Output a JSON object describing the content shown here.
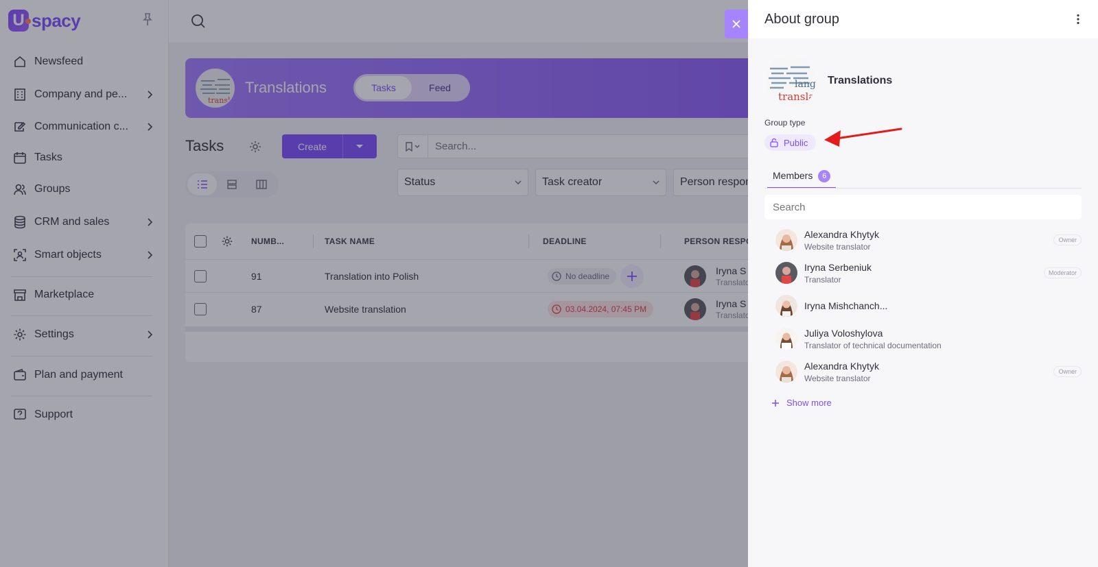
{
  "sidebar": {
    "logo": {
      "letter": "U",
      "text": "spacy"
    },
    "items": [
      {
        "label": "Newsfeed",
        "icon": "home-icon",
        "chevron": false
      },
      {
        "label": "Company and pe...",
        "icon": "building-icon",
        "chevron": true
      },
      {
        "label": "Communication c...",
        "icon": "chat-edit-icon",
        "chevron": true
      },
      {
        "label": "Tasks",
        "icon": "calendar-icon",
        "chevron": false
      },
      {
        "label": "Groups",
        "icon": "users-icon",
        "chevron": false
      },
      {
        "label": "CRM and sales",
        "icon": "database-icon",
        "chevron": true
      },
      {
        "label": "Smart objects",
        "icon": "scan-user-icon",
        "chevron": true
      },
      {
        "label": "Marketplace",
        "icon": "store-icon",
        "chevron": false
      },
      {
        "label": "Settings",
        "icon": "gear-icon",
        "chevron": true
      },
      {
        "label": "Plan and payment",
        "icon": "wallet-icon",
        "chevron": false
      },
      {
        "label": "Support",
        "icon": "help-icon",
        "chevron": false
      }
    ]
  },
  "banner": {
    "title": "Translations",
    "tabs": [
      {
        "label": "Tasks",
        "active": true
      },
      {
        "label": "Feed",
        "active": false
      }
    ]
  },
  "toolbar": {
    "title": "Tasks",
    "create_label": "Create",
    "search_placeholder": "Search..."
  },
  "filters": [
    "Status",
    "Task creator",
    "Person respon"
  ],
  "table": {
    "headers": [
      "NUMB...",
      "TASK NAME",
      "DEADLINE",
      "PERSON RESPON"
    ],
    "rows": [
      {
        "number": "91",
        "name": "Translation into Polish",
        "deadline": "No deadline",
        "overdue": false,
        "person": "Iryna S",
        "person_role": "Translato"
      },
      {
        "number": "87",
        "name": "Website translation",
        "deadline": "03.04.2024, 07:45 PM",
        "overdue": true,
        "person": "Iryna S",
        "person_role": "Translato"
      }
    ]
  },
  "panel": {
    "title": "About group",
    "group_name": "Translations",
    "group_type_label": "Group type",
    "group_type_value": "Public",
    "members_tab": "Members",
    "members_count": "6",
    "search_placeholder": "Search",
    "members": [
      {
        "name": "Alexandra Khytyk",
        "role": "Website translator",
        "tag": "Owner"
      },
      {
        "name": "Iryna Serbeniuk",
        "role": "Translator",
        "tag": "Moderator"
      },
      {
        "name": "Iryna Mishchanch...",
        "role": "",
        "tag": ""
      },
      {
        "name": "Juliya Voloshylova",
        "role": "Translator of technical documentation",
        "tag": ""
      },
      {
        "name": "Alexandra Khytyk",
        "role": "Website translator",
        "tag": "Owner"
      }
    ],
    "show_more": "Show more"
  },
  "colors": {
    "accent": "#7b4dff",
    "annotation_arrow": "#e31b1b",
    "overdue": "#e03e3e"
  }
}
